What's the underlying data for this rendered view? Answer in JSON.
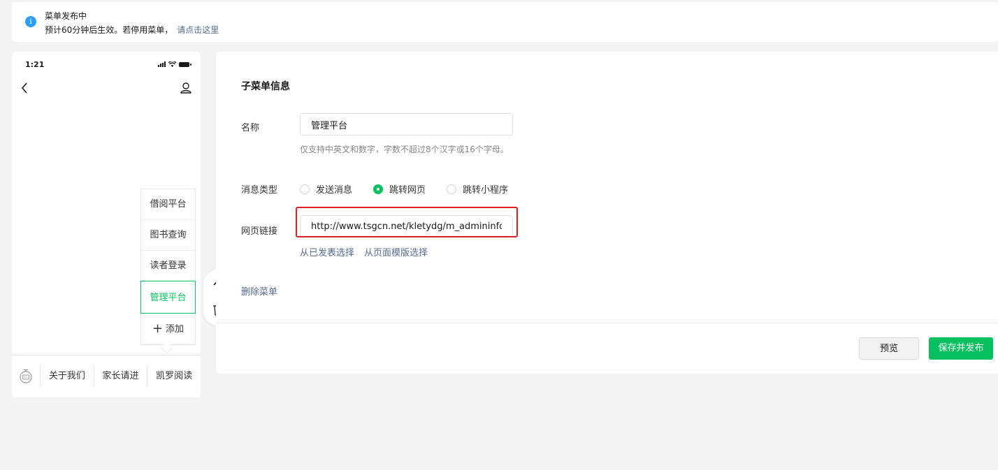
{
  "notice": {
    "title": "菜单发布中",
    "desc": "预计60分钟后生效。若停用菜单，",
    "link": "请点击这里",
    "icon": "info-icon",
    "icon_text": "i"
  },
  "phone": {
    "time": "1:21",
    "submenu": [
      {
        "label": "借阅平台",
        "active": false
      },
      {
        "label": "图书查询",
        "active": false
      },
      {
        "label": "读者登录",
        "active": false
      },
      {
        "label": "管理平台",
        "active": true
      }
    ],
    "add_label": "添加",
    "add_icon": "+",
    "menu_tabs": [
      "关于我们",
      "家长请进",
      "凯罗阅读"
    ]
  },
  "editor": {
    "title": "子菜单信息",
    "name_label": "名称",
    "name_value": "管理平台",
    "name_hint": "仅支持中英文和数字，字数不超过8个汉字或16个字母。",
    "type_label": "消息类型",
    "types": [
      {
        "label": "发送消息",
        "selected": false
      },
      {
        "label": "跳转网页",
        "selected": true
      },
      {
        "label": "跳转小程序",
        "selected": false
      }
    ],
    "url_label": "网页链接",
    "url_value": "http://www.tsgcn.net/kletydg/m_admininfo.as",
    "url_link_published": "从已发表选择",
    "url_link_template": "从页面模版选择",
    "delete_label": "删除菜单",
    "preview_button": "预览",
    "save_button": "保存并发布"
  },
  "colors": {
    "accent": "#07c160",
    "link": "#576b95",
    "highlight": "#e02020",
    "info": "#2c9dfd"
  }
}
